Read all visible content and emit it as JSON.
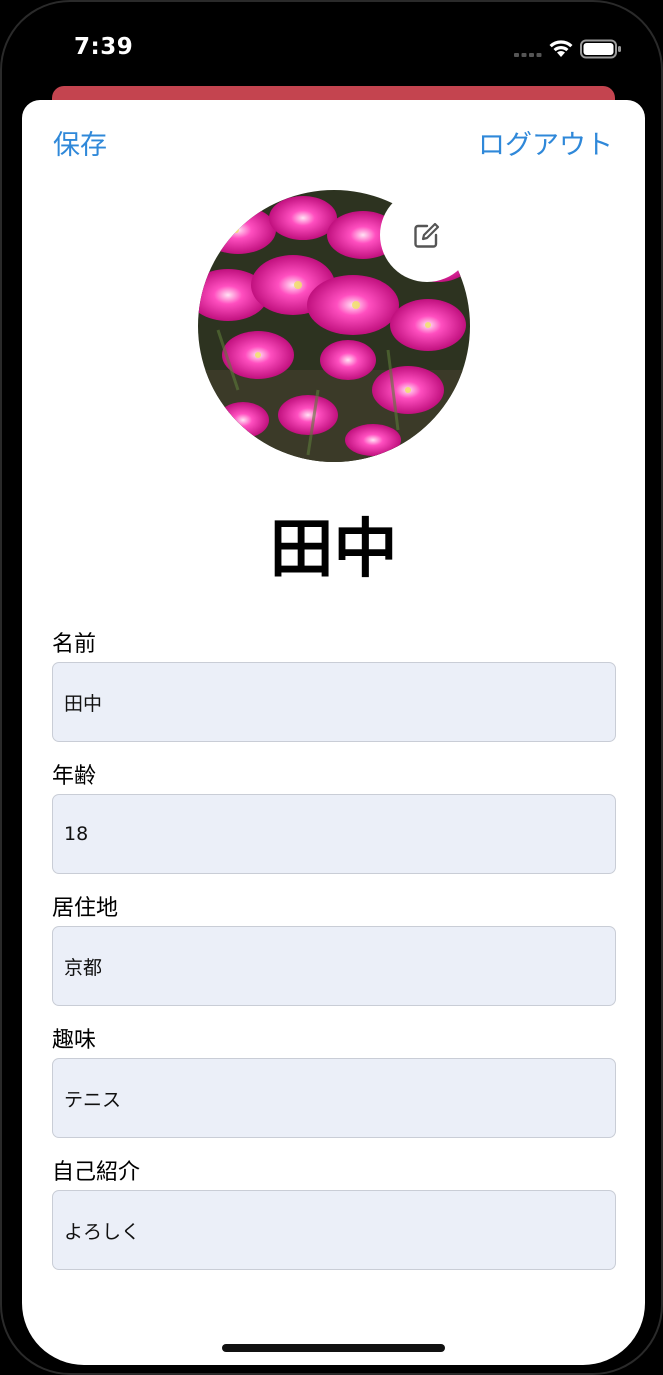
{
  "status_bar": {
    "time": "7:39"
  },
  "nav": {
    "save_label": "保存",
    "logout_label": "ログアウト"
  },
  "profile": {
    "display_name": "田中",
    "avatar_icon": "flower-photo",
    "edit_icon": "edit-icon"
  },
  "fields": [
    {
      "label": "名前",
      "value": "田中"
    },
    {
      "label": "年齢",
      "value": "18"
    },
    {
      "label": "居住地",
      "value": "京都"
    },
    {
      "label": "趣味",
      "value": "テニス"
    },
    {
      "label": "自己紹介",
      "value": "よろしく"
    }
  ],
  "colors": {
    "accent": "#2f88d9",
    "back_sheet": "#c4444f",
    "field_bg": "#ebeff8",
    "flower": "#e0189a"
  }
}
